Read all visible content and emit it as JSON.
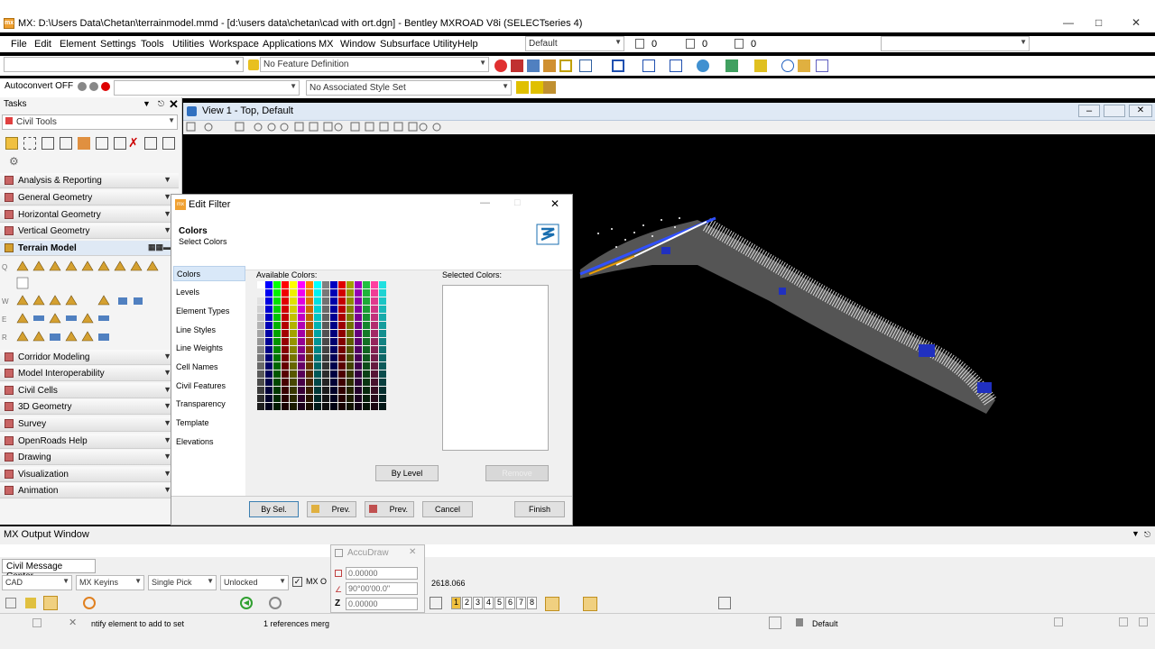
{
  "window": {
    "title": "MX: D:\\Users Data\\Chetan\\terrainmodel.mmd - [d:\\users data\\chetan\\cad with ort.dgn] - Bentley MXROAD V8i (SELECTseries 4)",
    "app_icon_text": "mx"
  },
  "menu": [
    "File",
    "Edit",
    "Element",
    "Settings",
    "Tools",
    "Utilities",
    "Workspace",
    "Applications",
    "MX",
    "Window",
    "Subsurface Utility",
    "Help"
  ],
  "toolbar": {
    "level_combo": "Default",
    "count1": "0",
    "count2": "0",
    "count3": "0",
    "feature_definition": "No Feature Definition",
    "autoconvert": "Autoconvert OFF",
    "style_set": "No Associated Style Set"
  },
  "tasks": {
    "header": "Tasks",
    "combo": "Civil Tools",
    "sections": [
      "Analysis & Reporting",
      "General Geometry",
      "Horizontal Geometry",
      "Vertical Geometry"
    ],
    "terrain": "Terrain Model",
    "side_letters": [
      "Q",
      "W",
      "E",
      "R"
    ],
    "sections2": [
      "Corridor Modeling",
      "Model Interoperability",
      "Civil Cells",
      "3D Geometry",
      "Survey",
      "OpenRoads Help",
      "Drawing",
      "Visualization",
      "Animation"
    ]
  },
  "view": {
    "title": "View 1 - Top, Default"
  },
  "dialog": {
    "title": "Edit Filter",
    "heading": "Colors",
    "subheading": "Select Colors",
    "nav": [
      "Colors",
      "Levels",
      "Element Types",
      "Line Styles",
      "Line Weights",
      "Cell Names",
      "Civil Features",
      "Transparency",
      "Template",
      "Elevations"
    ],
    "available_label": "Available Colors:",
    "selected_label": "Selected Colors:",
    "by_level": "By Level",
    "remove": "Remove",
    "buttons": {
      "by_sel": "By Sel.",
      "prev1": "Prev.",
      "prev2": "Prev.",
      "cancel": "Cancel",
      "finish": "Finish"
    }
  },
  "output": {
    "title": "MX Output Window",
    "tab": "Civil Message Center",
    "combo_cad": "CAD",
    "combo_keyins": "MX Keyins",
    "combo_pick": "Single Pick",
    "combo_unlocked": "Unlocked",
    "mx_label": "MX O",
    "coord": "2618.066",
    "view_numbers": [
      "1",
      "2",
      "3",
      "4",
      "5",
      "6",
      "7",
      "8"
    ]
  },
  "accudraw": {
    "title": "AccuDraw",
    "x": "0.00000",
    "angle": "90°00'00.0\"",
    "z_label": "Z",
    "z": "0.00000"
  },
  "status": {
    "prompt": "ntify element to add to set",
    "refs": "1 references merg",
    "level": "Default"
  },
  "colors": {
    "accent": "#1e5aa8",
    "palette_top": [
      "#ffffff",
      "#0000ff",
      "#00ff00",
      "#ff0000",
      "#ffff00",
      "#ff00ff",
      "#ff7f00",
      "#00ffff",
      "#808080",
      "#c0c0c0",
      "#e00000",
      "#0000c0",
      "#a0a000",
      "#8000ff",
      "#00c040",
      "#ff40a0",
      "#40e0e0",
      "#20ffff"
    ]
  }
}
